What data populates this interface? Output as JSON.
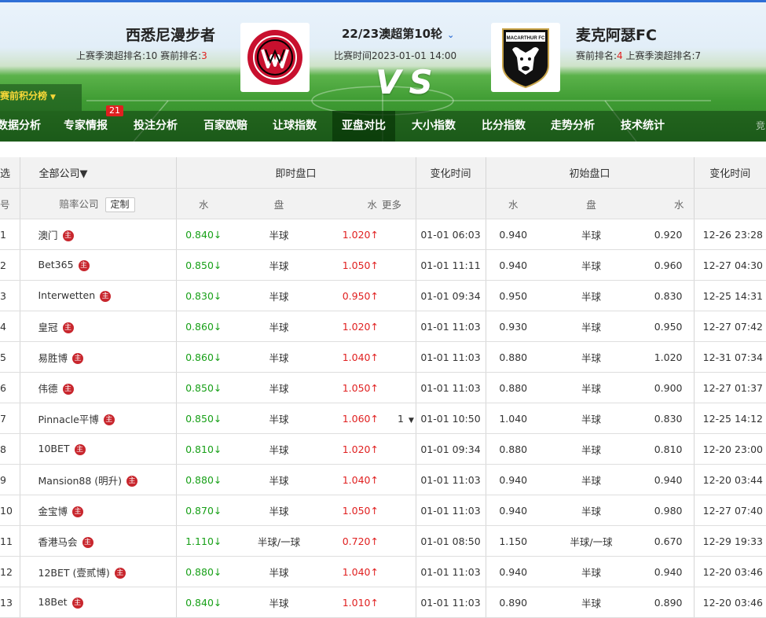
{
  "match": {
    "home_team": "西悉尼漫步者",
    "away_team": "麦克阿瑟FC",
    "home_meta_prefix": "上赛季澳超排名:10  赛前排名:",
    "home_rank": "3",
    "away_meta_prefix": "赛前排名:",
    "away_rank": "4",
    "away_meta_suffix": "  上赛季澳超排名:7",
    "round": "22/23澳超第10轮",
    "match_time": "比赛时间2023-01-01 14:00",
    "vs": "VS",
    "away_logo_text": "MACARTHUR FC"
  },
  "standings_label": "赛前积分榜",
  "nav": {
    "items": [
      "数据分析",
      "专家情报",
      "投注分析",
      "百家欧赔",
      "让球指数",
      "亚盘对比",
      "大小指数",
      "比分指数",
      "走势分析",
      "技术统计"
    ],
    "active": "亚盘对比",
    "badge": "21",
    "tail": "竞"
  },
  "table": {
    "col_select": "选",
    "all_companies": "全部公司",
    "live_group": "即时盘口",
    "change_time": "变化时间",
    "init_group": "初始盘口",
    "change_time2": "变化时间",
    "no_label": "号",
    "company_label": "赔率公司",
    "custom_btn": "定制",
    "water": "水",
    "handicap": "盘",
    "water2": "水",
    "more": "更多",
    "init_water": "水",
    "init_handicap": "盘",
    "init_water2": "水",
    "crown_glyph": "主",
    "down_arrow": "↓",
    "up_arrow": "↑",
    "rows": [
      {
        "no": "1",
        "company": "澳门",
        "live_home": "0.840",
        "live_line": "半球",
        "live_away": "1.020",
        "more": "",
        "change": "01-01 06:03",
        "init_home": "0.940",
        "init_line": "半球",
        "init_away": "0.920",
        "init_change": "12-26 23:28"
      },
      {
        "no": "2",
        "company": "Bet365",
        "live_home": "0.850",
        "live_line": "半球",
        "live_away": "1.050",
        "more": "",
        "change": "01-01 11:11",
        "init_home": "0.940",
        "init_line": "半球",
        "init_away": "0.960",
        "init_change": "12-27 04:30"
      },
      {
        "no": "3",
        "company": "Interwetten",
        "live_home": "0.830",
        "live_line": "半球",
        "live_away": "0.950",
        "more": "",
        "change": "01-01 09:34",
        "init_home": "0.950",
        "init_line": "半球",
        "init_away": "0.830",
        "init_change": "12-25 14:31"
      },
      {
        "no": "4",
        "company": "皇冠",
        "live_home": "0.860",
        "live_line": "半球",
        "live_away": "1.020",
        "more": "",
        "change": "01-01 11:03",
        "init_home": "0.930",
        "init_line": "半球",
        "init_away": "0.950",
        "init_change": "12-27 07:42"
      },
      {
        "no": "5",
        "company": "易胜博",
        "live_home": "0.860",
        "live_line": "半球",
        "live_away": "1.040",
        "more": "",
        "change": "01-01 11:03",
        "init_home": "0.880",
        "init_line": "半球",
        "init_away": "1.020",
        "init_change": "12-31 07:34"
      },
      {
        "no": "6",
        "company": "伟德",
        "live_home": "0.850",
        "live_line": "半球",
        "live_away": "1.050",
        "more": "",
        "change": "01-01 11:03",
        "init_home": "0.880",
        "init_line": "半球",
        "init_away": "0.900",
        "init_change": "12-27 01:37"
      },
      {
        "no": "7",
        "company": "Pinnacle平博",
        "live_home": "0.850",
        "live_line": "半球",
        "live_away": "1.060",
        "more": "1",
        "change": "01-01 10:50",
        "init_home": "1.040",
        "init_line": "半球",
        "init_away": "0.830",
        "init_change": "12-25 14:12"
      },
      {
        "no": "8",
        "company": "10BET",
        "live_home": "0.810",
        "live_line": "半球",
        "live_away": "1.020",
        "more": "",
        "change": "01-01 09:34",
        "init_home": "0.880",
        "init_line": "半球",
        "init_away": "0.810",
        "init_change": "12-20 23:00"
      },
      {
        "no": "9",
        "company": "Mansion88 (明升)",
        "live_home": "0.880",
        "live_line": "半球",
        "live_away": "1.040",
        "more": "",
        "change": "01-01 11:03",
        "init_home": "0.940",
        "init_line": "半球",
        "init_away": "0.940",
        "init_change": "12-20 03:44"
      },
      {
        "no": "10",
        "company": "金宝博",
        "live_home": "0.870",
        "live_line": "半球",
        "live_away": "1.050",
        "more": "",
        "change": "01-01 11:03",
        "init_home": "0.940",
        "init_line": "半球",
        "init_away": "0.980",
        "init_change": "12-27 07:40"
      },
      {
        "no": "11",
        "company": "香港马会",
        "live_home": "1.110",
        "live_line": "半球/一球",
        "live_away": "0.720",
        "more": "",
        "change": "01-01 08:50",
        "init_home": "1.150",
        "init_line": "半球/一球",
        "init_away": "0.670",
        "init_change": "12-29 19:33"
      },
      {
        "no": "12",
        "company": "12BET (壹贰博)",
        "live_home": "0.880",
        "live_line": "半球",
        "live_away": "1.040",
        "more": "",
        "change": "01-01 11:03",
        "init_home": "0.940",
        "init_line": "半球",
        "init_away": "0.940",
        "init_change": "12-20 03:46"
      },
      {
        "no": "13",
        "company": "18Bet",
        "live_home": "0.840",
        "live_line": "半球",
        "live_away": "1.010",
        "more": "",
        "change": "01-01 11:03",
        "init_home": "0.890",
        "init_line": "半球",
        "init_away": "0.890",
        "init_change": "12-20 03:46"
      }
    ]
  }
}
